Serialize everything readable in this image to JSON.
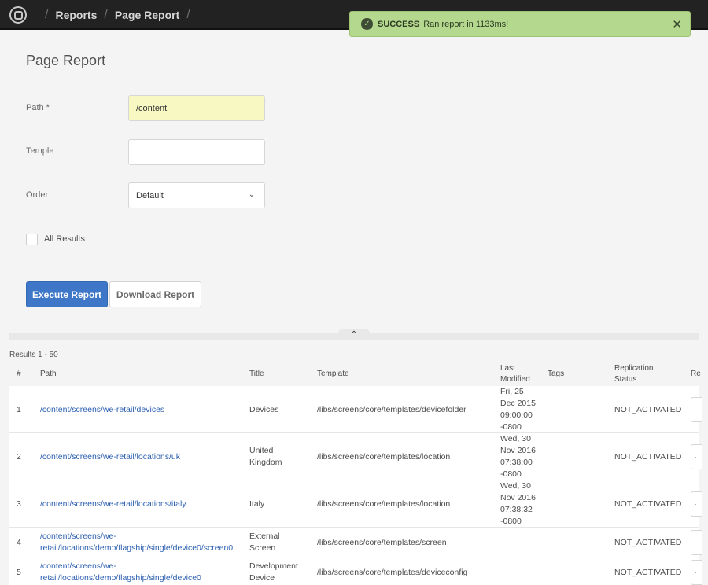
{
  "header": {
    "logo_icon": "aem-logo-icon",
    "breadcrumbs": [
      "Reports",
      "Page Report"
    ]
  },
  "toast": {
    "status": "SUCCESS",
    "message": "Ran report in 1133ms!",
    "close_glyph": "✕",
    "color": "#b4d88e"
  },
  "form": {
    "title": "Page Report",
    "path_label": "Path *",
    "path_value": "/content",
    "template_label": "Temple",
    "template_value": "",
    "order_label": "Order",
    "order_value": "Default",
    "all_results_label": "All Results",
    "all_results_checked": false,
    "execute_label": "Execute Report",
    "download_label": "Download Report"
  },
  "results": {
    "count_label": "Results 1 - 50",
    "columns": [
      "#",
      "Path",
      "Title",
      "Template",
      "Last Modified",
      "Tags",
      "Replication Status",
      "Re"
    ],
    "rows": [
      {
        "num": "1",
        "path": "/content/screens/we-retail/devices",
        "title": "Devices",
        "template": "/libs/screens/core/templates/devicefolder",
        "modified": "Fri, 25 Dec 2015 09:00:00 -0800",
        "tags": "",
        "status": "NOT_ACTIVATED"
      },
      {
        "num": "2",
        "path": "/content/screens/we-retail/locations/uk",
        "title": "United Kingdom",
        "template": "/libs/screens/core/templates/location",
        "modified": "Wed, 30 Nov 2016 07:38:00 -0800",
        "tags": "",
        "status": "NOT_ACTIVATED"
      },
      {
        "num": "3",
        "path": "/content/screens/we-retail/locations/italy",
        "title": "Italy",
        "template": "/libs/screens/core/templates/location",
        "modified": "Wed, 30 Nov 2016 07:38:32 -0800",
        "tags": "",
        "status": "NOT_ACTIVATED"
      },
      {
        "num": "4",
        "path": "/content/screens/we-retail/locations/demo/flagship/single/device0/screen0",
        "title": "External Screen",
        "template": "/libs/screens/core/templates/screen",
        "modified": "",
        "tags": "",
        "status": "NOT_ACTIVATED"
      },
      {
        "num": "5",
        "path": "/content/screens/we-retail/locations/demo/flagship/single/device0",
        "title": "Development Device",
        "template": "/libs/screens/core/templates/deviceconfig",
        "modified": "",
        "tags": "",
        "status": "NOT_ACTIVATED"
      }
    ]
  }
}
